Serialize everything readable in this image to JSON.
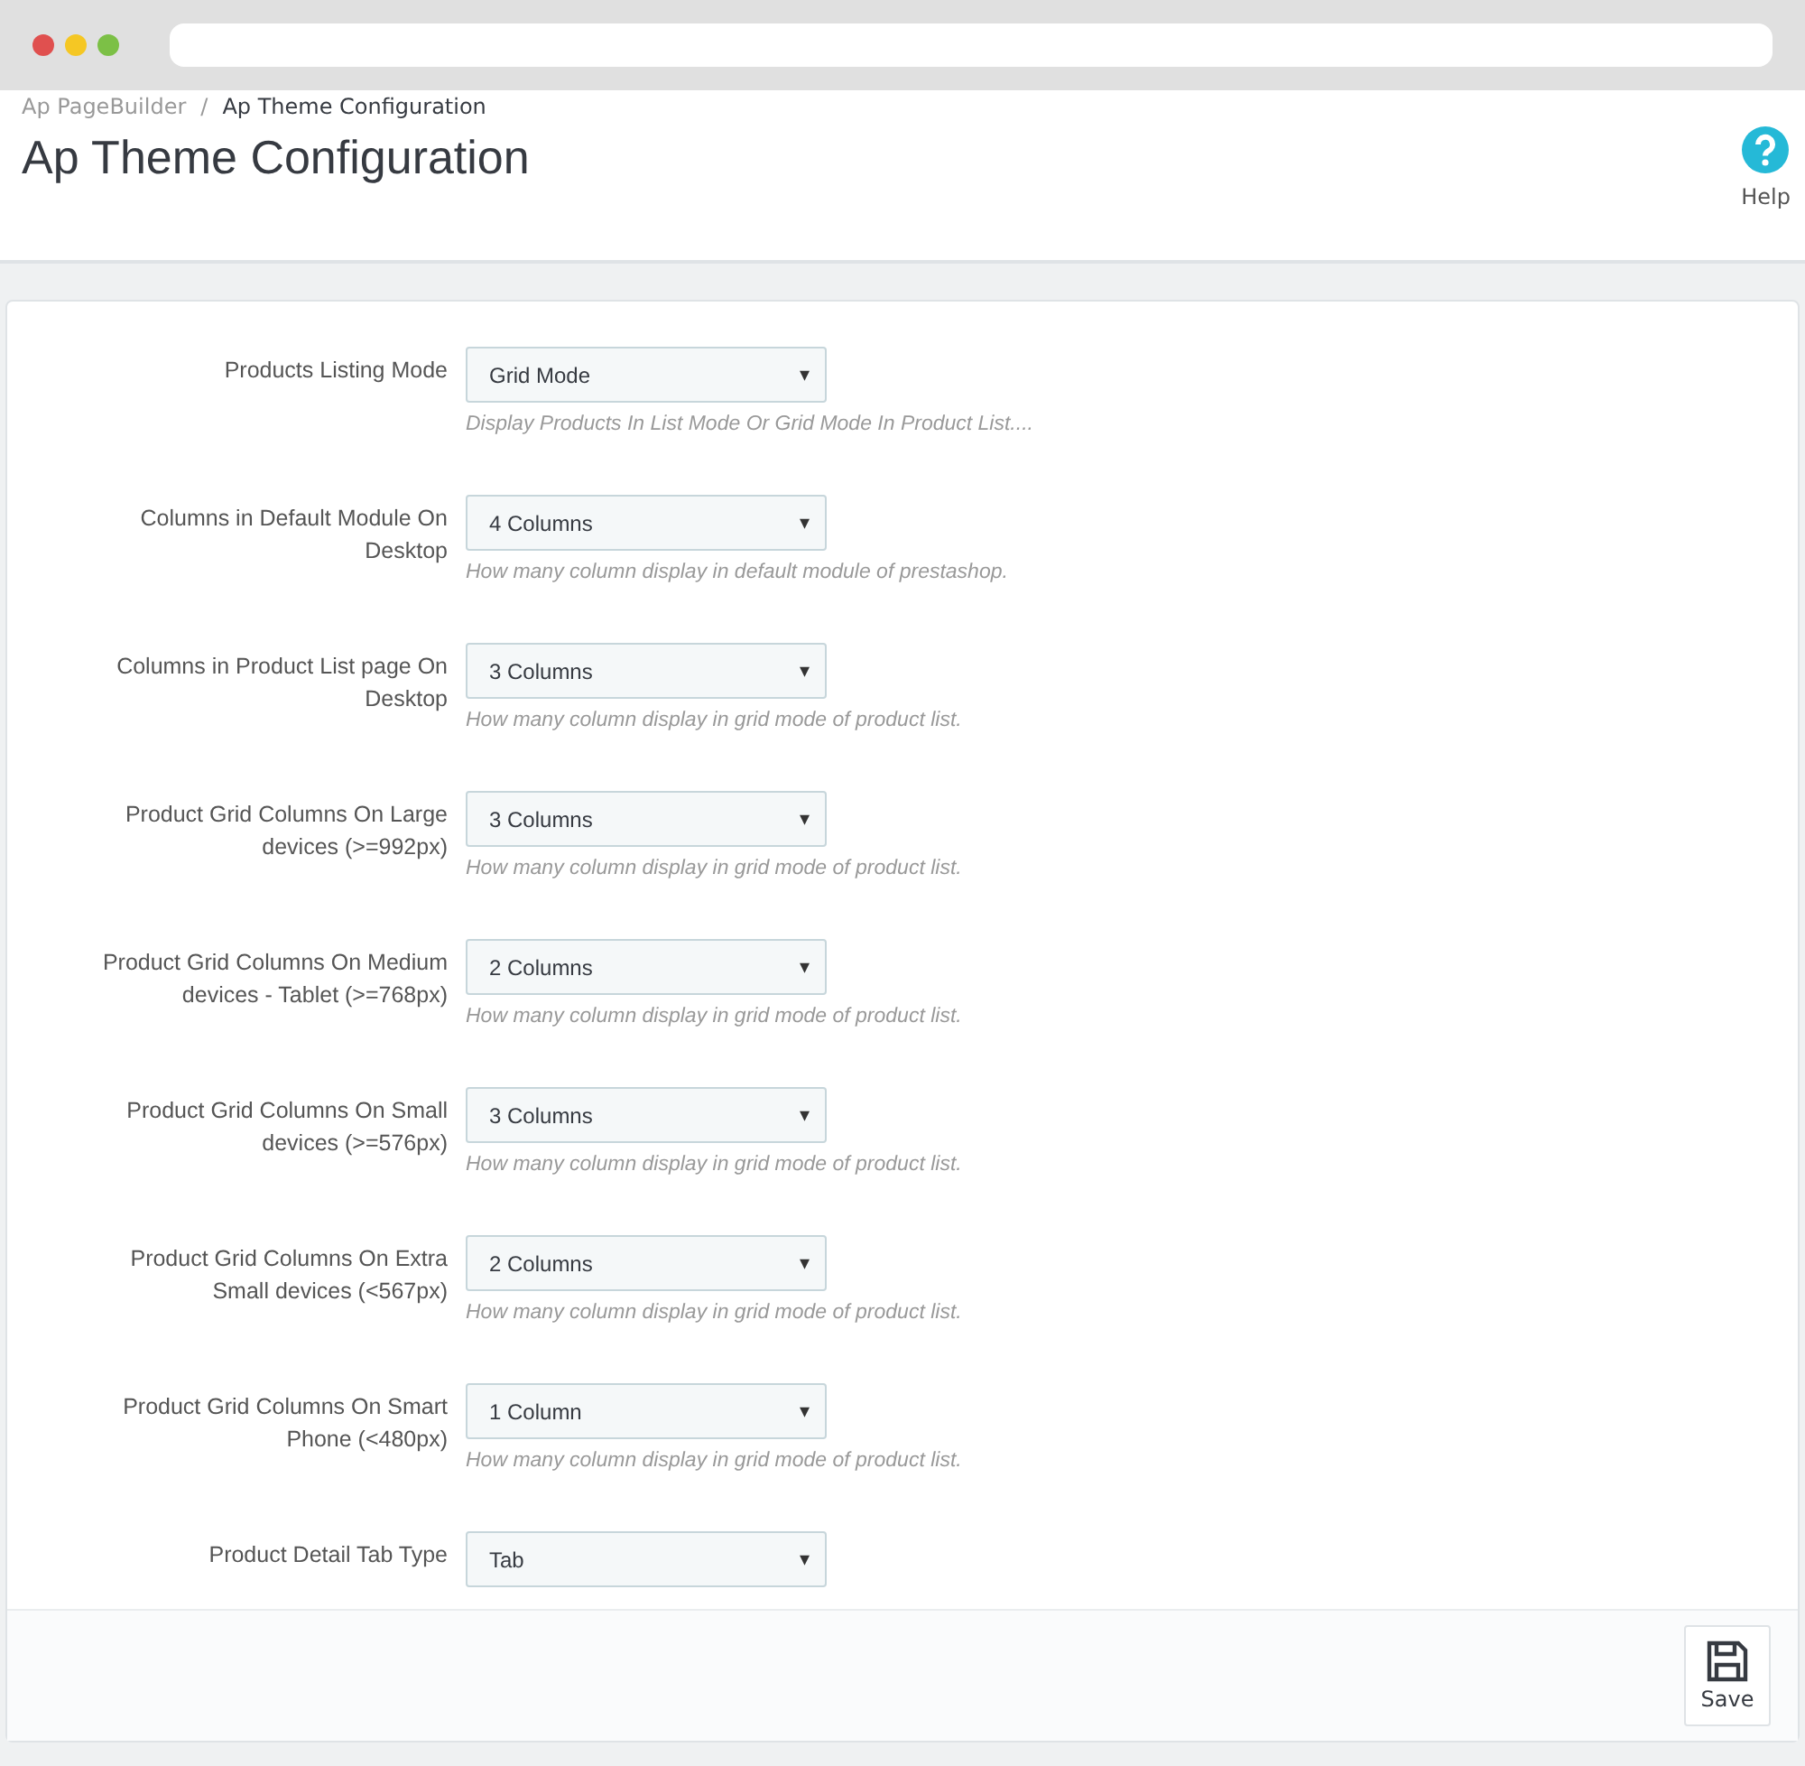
{
  "breadcrumb": [
    {
      "label": "Ap PageBuilder",
      "kind": "link"
    },
    {
      "label": "Ap Theme Configuration",
      "kind": "current"
    }
  ],
  "breadcrumb_separator": "/",
  "page_title": "Ap Theme Configuration",
  "help_button": {
    "label": "Help"
  },
  "fields": [
    {
      "label": "Products Listing Mode",
      "value": "Grid Mode",
      "help": "Display Products In List Mode Or Grid Mode In Product List...."
    },
    {
      "label": "Columns in Default Module On Desktop",
      "value": "4 Columns",
      "help": "How many column display in default module of prestashop."
    },
    {
      "label": "Columns in Product List page On Desktop",
      "value": "3 Columns",
      "help": "How many column display in grid mode of product list."
    },
    {
      "label": "Product Grid Columns On Large devices (>=992px)",
      "value": "3 Columns",
      "help": "How many column display in grid mode of product list."
    },
    {
      "label": "Product Grid Columns On Medium devices - Tablet (>=768px)",
      "value": "2 Columns",
      "help": "How many column display in grid mode of product list."
    },
    {
      "label": "Product Grid Columns On Small devices (>=576px)",
      "value": "3 Columns",
      "help": "How many column display in grid mode of product list."
    },
    {
      "label": "Product Grid Columns On Extra Small devices (<567px)",
      "value": "2 Columns",
      "help": "How many column display in grid mode of product list."
    },
    {
      "label": "Product Grid Columns On Smart Phone (<480px)",
      "value": "1 Column",
      "help": "How many column display in grid mode of product list."
    },
    {
      "label": "Product Detail Tab Type",
      "value": "Tab"
    }
  ],
  "save_button": {
    "label": "Save"
  },
  "select_caret": "▾"
}
